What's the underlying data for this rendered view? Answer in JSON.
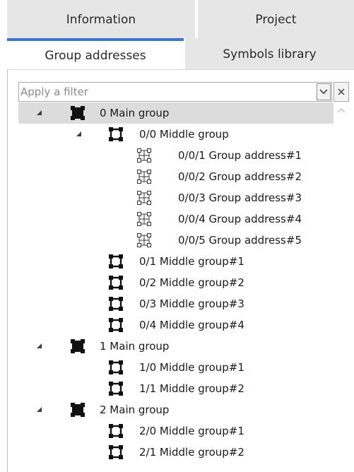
{
  "tabs": {
    "information": "Information",
    "project": "Project",
    "group_addresses": "Group addresses",
    "symbols_library": "Symbols library",
    "accent_color": "#3a73d8"
  },
  "filter": {
    "placeholder": "Apply a filter",
    "value": ""
  },
  "tree": [
    {
      "label": "0 Main group",
      "level": 0,
      "kind": "main",
      "expanded": true,
      "selected": true
    },
    {
      "label": "0/0 Middle group",
      "level": 1,
      "kind": "middle",
      "expanded": true
    },
    {
      "label": "0/0/1 Group address#1",
      "level": 2,
      "kind": "address"
    },
    {
      "label": "0/0/2 Group address#2",
      "level": 2,
      "kind": "address"
    },
    {
      "label": "0/0/3 Group address#3",
      "level": 2,
      "kind": "address"
    },
    {
      "label": "0/0/4 Group address#4",
      "level": 2,
      "kind": "address"
    },
    {
      "label": "0/0/5 Group address#5",
      "level": 2,
      "kind": "address"
    },
    {
      "label": "0/1 Middle group#1",
      "level": 1,
      "kind": "middle"
    },
    {
      "label": "0/2 Middle group#2",
      "level": 1,
      "kind": "middle"
    },
    {
      "label": "0/3 Middle group#3",
      "level": 1,
      "kind": "middle"
    },
    {
      "label": "0/4 Middle group#4",
      "level": 1,
      "kind": "middle"
    },
    {
      "label": "1 Main group",
      "level": 0,
      "kind": "main",
      "expanded": true
    },
    {
      "label": "1/0 Middle group#1",
      "level": 1,
      "kind": "middle"
    },
    {
      "label": "1/1 Middle group#2",
      "level": 1,
      "kind": "middle"
    },
    {
      "label": "2 Main group",
      "level": 0,
      "kind": "main",
      "expanded": true
    },
    {
      "label": "2/0 Middle group#1",
      "level": 1,
      "kind": "middle"
    },
    {
      "label": "2/1 Middle group#2",
      "level": 1,
      "kind": "middle"
    }
  ]
}
